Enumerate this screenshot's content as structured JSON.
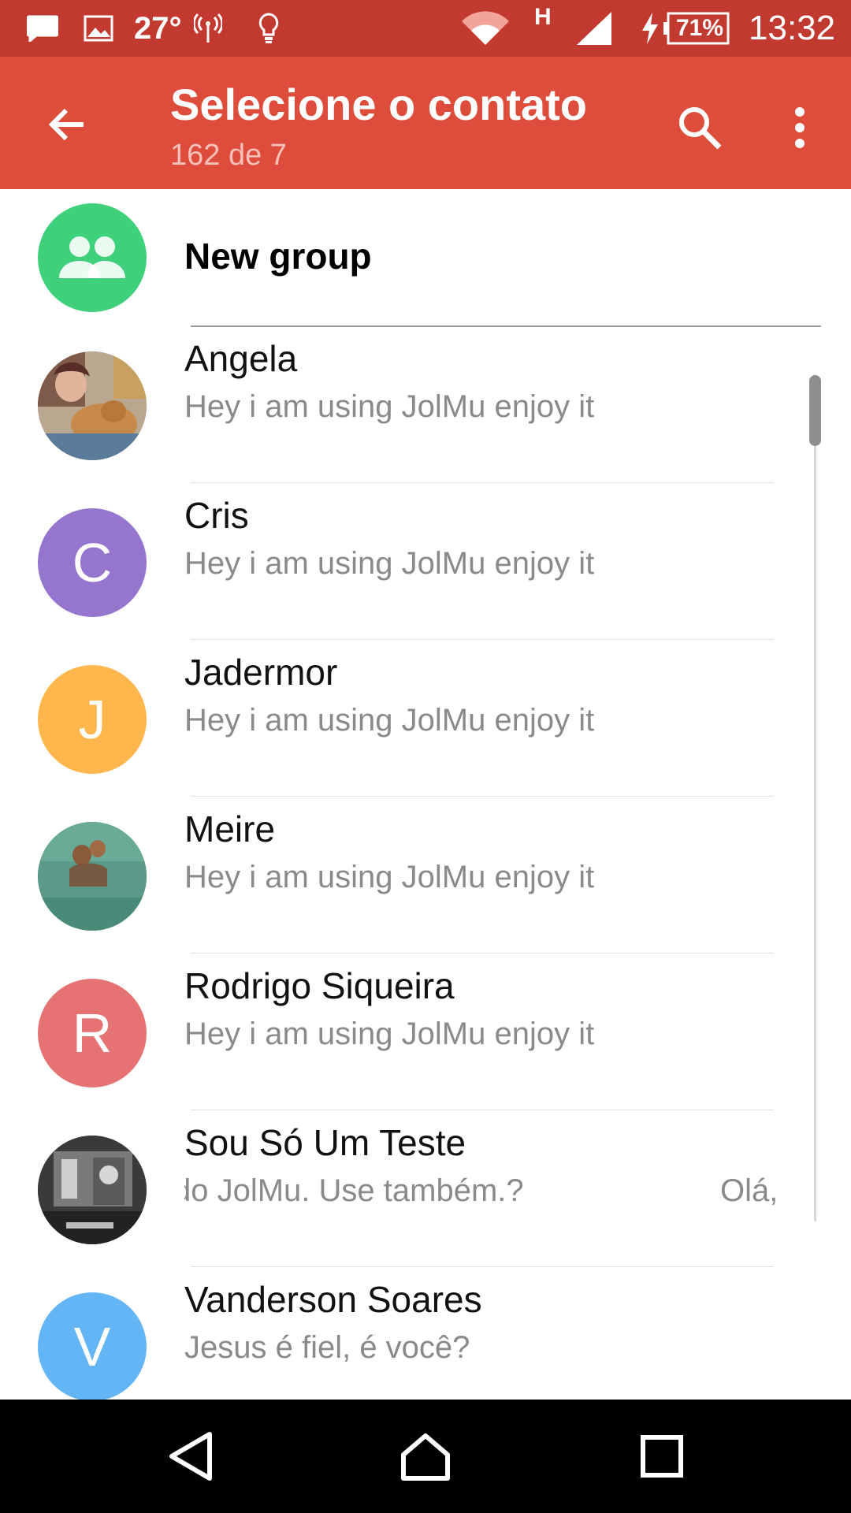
{
  "status_bar": {
    "temperature": "27°",
    "network_type": "H",
    "battery": "71%",
    "time": "13:32",
    "icons": [
      "message-icon",
      "image-icon",
      "antenna-icon",
      "bulb-icon",
      "wifi-icon",
      "signal-icon",
      "charging-icon",
      "battery-icon"
    ]
  },
  "app_bar": {
    "title": "Selecione o contato",
    "subtitle": "162 de 7",
    "background": "#de4d3c",
    "status_background": "#c1392f"
  },
  "new_group": {
    "label": "New group",
    "avatar_color": "#3fd07b"
  },
  "contacts": [
    {
      "name": "Angela",
      "status": "Hey i am using JolMu enjoy it",
      "avatar": "photo"
    },
    {
      "name": "Cris",
      "status": "Hey i am using JolMu enjoy it",
      "avatar": "initial",
      "initial": "C",
      "color": "#9575cd"
    },
    {
      "name": "Jadermor",
      "status": "Hey i am using JolMu enjoy it",
      "avatar": "initial",
      "initial": "J",
      "color": "#ffb74d"
    },
    {
      "name": "Meire",
      "status": "Hey i am using JolMu enjoy it",
      "avatar": "photo"
    },
    {
      "name": "Rodrigo Siqueira",
      "status": "Hey i am using JolMu enjoy it",
      "avatar": "initial",
      "initial": "R",
      "color": "#e57373"
    },
    {
      "name": "Sou Só Um Teste",
      "status_part1": "do JolMu. Use também.?",
      "status_part2": "Olá,",
      "avatar": "photo"
    },
    {
      "name": "Vanderson Soares",
      "status": "Jesus é fiel, é você?",
      "avatar": "initial",
      "initial": "V",
      "color": "#64b5f6"
    }
  ],
  "nav_bar": {
    "icons": [
      "back-nav-icon",
      "home-nav-icon",
      "recents-nav-icon"
    ]
  }
}
